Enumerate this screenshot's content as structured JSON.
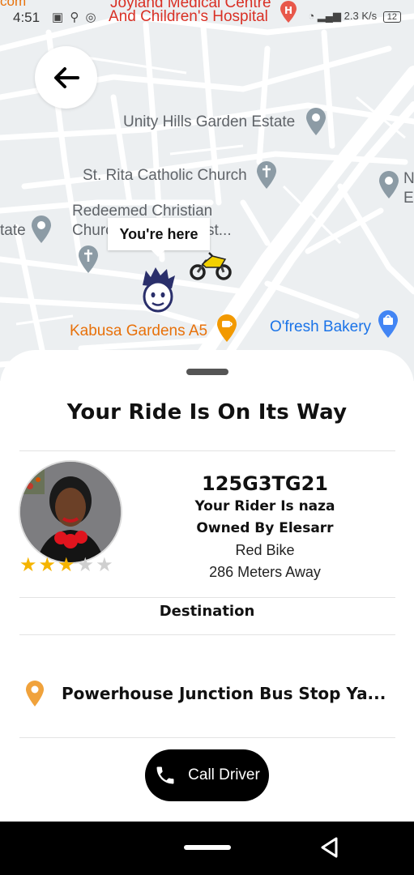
{
  "status_bar": {
    "time": "4:51",
    "left_icons": "▣ ⚲ ◎",
    "network_speed": "2.3 K/s",
    "battery": "12"
  },
  "map": {
    "labels": {
      "hospital_top": "Joyland Medical Centre",
      "hospital": "And Children's Hospital",
      "unity_hills": "Unity Hills Garden Estate",
      "st_rita": "St. Rita Catholic Church",
      "redeemed_1": "Redeemed Christian",
      "redeemed_2": "Churc",
      "redeemed_2_tail": "st...",
      "estate_left": "tate",
      "n_right": "N",
      "e_right": "E",
      "kabusa": "Kabusa Gardens A5",
      "ofresh": "O'fresh Bakery",
      "top_left_fragment": "com"
    },
    "you_are_here": "You're here"
  },
  "sheet": {
    "title": "Your Ride Is On Its Way",
    "plate": "125G3TG21",
    "rider_name": "Your Rider Is naza",
    "owner": "Owned By Elesarr",
    "bike": "Red Bike",
    "distance": "286 Meters Away",
    "rating": 3,
    "rating_max": 5,
    "destination_label": "Destination",
    "destination": "Powerhouse Junction Bus Stop Ya...",
    "call_button": "Call Driver"
  },
  "colors": {
    "accent_orange": "#f0a23b",
    "star": "#f5b400",
    "button": "#000000"
  }
}
